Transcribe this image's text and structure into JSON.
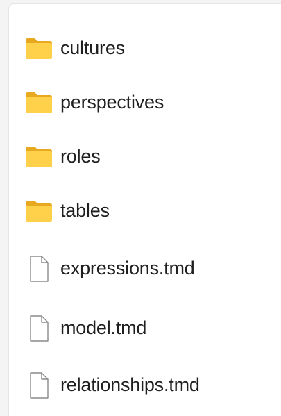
{
  "explorer": {
    "items": [
      {
        "name": "cultures",
        "type": "folder",
        "icon": "folder-icon"
      },
      {
        "name": "perspectives",
        "type": "folder",
        "icon": "folder-icon"
      },
      {
        "name": "roles",
        "type": "folder",
        "icon": "folder-icon"
      },
      {
        "name": "tables",
        "type": "folder",
        "icon": "folder-icon"
      },
      {
        "name": "expressions.tmd",
        "type": "file",
        "icon": "file-icon"
      },
      {
        "name": "model.tmd",
        "type": "file",
        "icon": "file-icon"
      },
      {
        "name": "relationships.tmd",
        "type": "file",
        "icon": "file-icon"
      }
    ]
  },
  "colors": {
    "folder_back": "#e8a920",
    "folder_front": "#ffd04a",
    "file_outline": "#8a8a8a",
    "text": "#1f1f1f"
  }
}
